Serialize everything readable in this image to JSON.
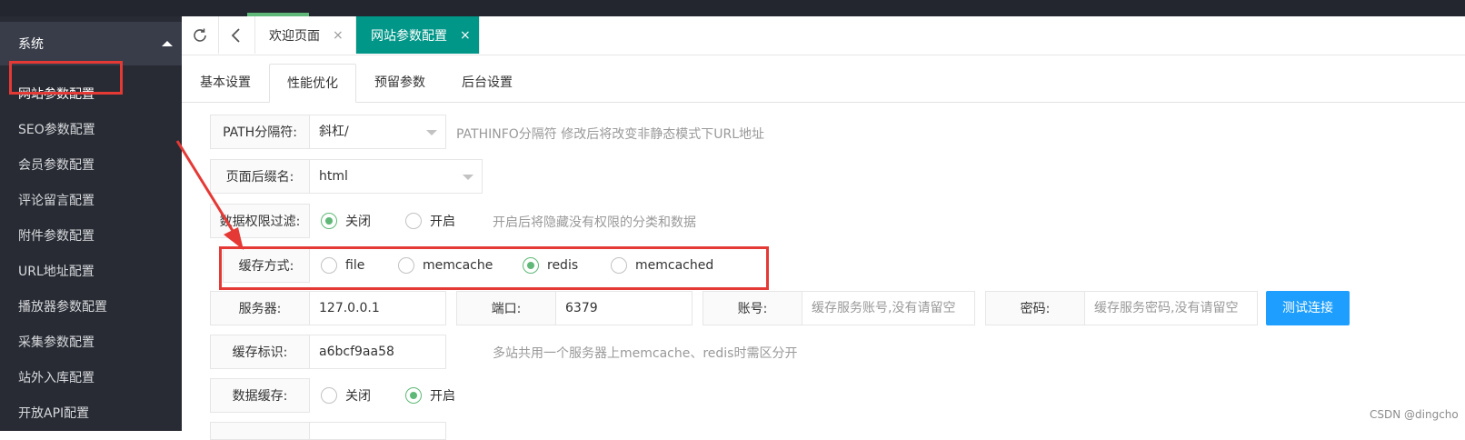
{
  "sidebar": {
    "section_label": "系统",
    "items": [
      {
        "label": "网站参数配置"
      },
      {
        "label": "SEO参数配置"
      },
      {
        "label": "会员参数配置"
      },
      {
        "label": "评论留言配置"
      },
      {
        "label": "附件参数配置"
      },
      {
        "label": "URL地址配置"
      },
      {
        "label": "播放器参数配置"
      },
      {
        "label": "采集参数配置"
      },
      {
        "label": "站外入库配置"
      },
      {
        "label": "开放API配置"
      }
    ]
  },
  "tabbar": {
    "refresh_icon": "refresh-icon",
    "back_icon": "chevron-left-icon",
    "tabs": [
      {
        "label": "欢迎页面",
        "close": "×"
      },
      {
        "label": "网站参数配置",
        "close": "×"
      }
    ]
  },
  "subtabs": [
    "基本设置",
    "性能优化",
    "预留参数",
    "后台设置"
  ],
  "form": {
    "path_sep": {
      "label": "PATH分隔符:",
      "value": "斜杠/",
      "hint": "PATHINFO分隔符 修改后将改变非静态模式下URL地址"
    },
    "suffix": {
      "label": "页面后缀名:",
      "value": "html"
    },
    "data_filter": {
      "label": "数据权限过滤:",
      "options": [
        "关闭",
        "开启"
      ],
      "hint": "开启后将隐藏没有权限的分类和数据"
    },
    "cache_type": {
      "label": "缓存方式:",
      "options": [
        "file",
        "memcache",
        "redis",
        "memcached"
      ]
    },
    "server": {
      "label": "服务器:",
      "value": "127.0.0.1"
    },
    "port": {
      "label": "端口:",
      "value": "6379"
    },
    "account": {
      "label": "账号:",
      "placeholder": "缓存服务账号,没有请留空"
    },
    "password": {
      "label": "密码:",
      "placeholder": "缓存服务密码,没有请留空"
    },
    "test_button": "测试连接",
    "cache_id": {
      "label": "缓存标识:",
      "value": "a6bcf9aa58",
      "hint": "多站共用一个服务器上memcache、redis时需区分开"
    },
    "data_cache": {
      "label": "数据缓存:",
      "options": [
        "关闭",
        "开启"
      ]
    }
  },
  "watermark": "CSDN @dingcho",
  "colors": {
    "teal": "#009688",
    "green": "#5fb878",
    "blue": "#1e9fff",
    "red": "#e53935",
    "sidebar": "#282b33"
  }
}
